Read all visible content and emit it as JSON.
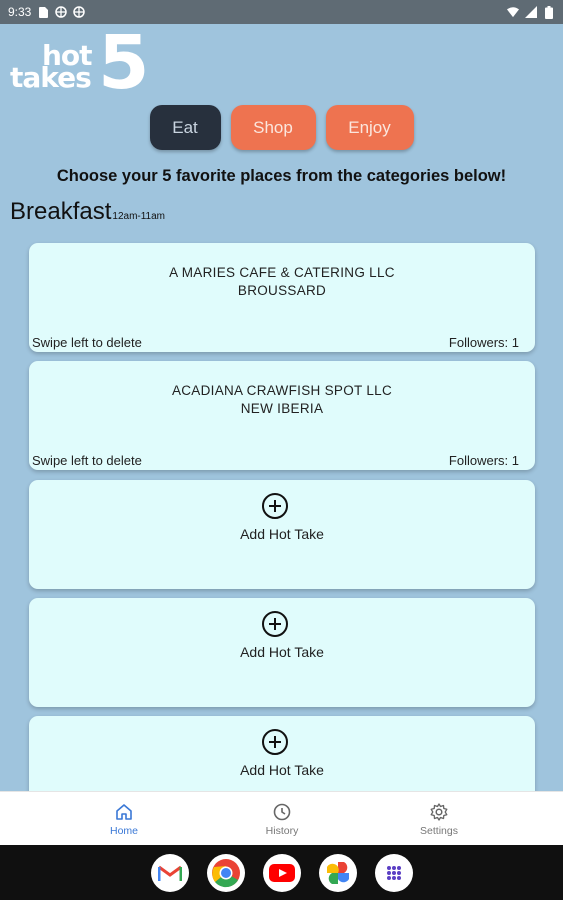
{
  "status_bar": {
    "time": "9:33",
    "left_icons": [
      "sim-card-icon",
      "globe-icon",
      "globe-icon"
    ],
    "right_icons": [
      "wifi-icon",
      "signal-icon",
      "battery-icon"
    ]
  },
  "logo": {
    "line1": "hot",
    "line2": "takes",
    "number": "5"
  },
  "tabs": [
    {
      "label": "Eat",
      "active": true
    },
    {
      "label": "Shop",
      "active": false
    },
    {
      "label": "Enjoy",
      "active": false
    }
  ],
  "instructions": "Choose your 5 favorite places from the categories below!",
  "section": {
    "title": "Breakfast",
    "hours": "12am-11am"
  },
  "cards": [
    {
      "name": "A MARIES CAFE & CATERING LLC",
      "location": "BROUSSARD",
      "swipe_hint": "Swipe left to delete",
      "followers": "Followers: 1"
    },
    {
      "name": "ACADIANA CRAWFISH SPOT LLC",
      "location": "NEW IBERIA",
      "swipe_hint": "Swipe left to delete",
      "followers": "Followers: 1"
    }
  ],
  "add_slots": [
    {
      "label": "Add Hot Take"
    },
    {
      "label": "Add Hot Take"
    },
    {
      "label": "Add Hot Take"
    }
  ],
  "bottom_nav": [
    {
      "label": "Home",
      "icon": "home-icon",
      "active": true
    },
    {
      "label": "History",
      "icon": "clock-icon",
      "active": false
    },
    {
      "label": "Settings",
      "icon": "gear-icon",
      "active": false
    }
  ],
  "dock": [
    "gmail-icon",
    "chrome-icon",
    "youtube-icon",
    "photos-icon",
    "app-drawer-icon"
  ],
  "colors": {
    "background": "#9fc4dd",
    "accent": "#ee7350",
    "active_tab": "#27303d",
    "card": "#e0fcfc",
    "nav_active": "#3a78d6"
  }
}
